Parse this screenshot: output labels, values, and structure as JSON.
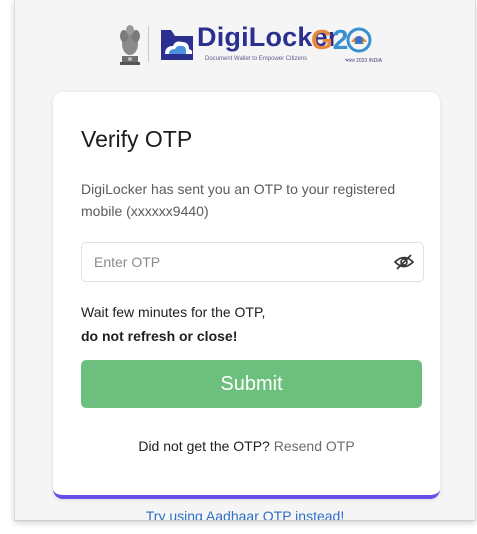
{
  "header": {
    "brand_name": "DigiLocker",
    "brand_tagline": "Document Wallet to Empower Citizens",
    "g20_mark": "G20",
    "g20_small": "भारत 2023 INDIA",
    "icons": [
      "national-emblem",
      "digilocker-cloud",
      "g20-logo"
    ]
  },
  "card": {
    "title": "Verify OTP",
    "description": "DigiLocker has sent you an OTP to your registered mobile (xxxxxx9440)",
    "otp_placeholder": "Enter OTP",
    "otp_value": "",
    "eye_icon": "eye-slash-icon",
    "wait_text": "Wait few minutes for the OTP,",
    "warning_text": "do not refresh or close!",
    "submit_label": "Submit",
    "resend_prompt": "Did not get the OTP?",
    "resend_link": "Resend OTP"
  },
  "footer": {
    "aadhaar_link": "Try using Aadhaar OTP instead!"
  },
  "colors": {
    "brand_blue": "#2b2f8f",
    "submit_green": "#6cbf7c",
    "accent_purple": "#6a4ce8",
    "link_blue": "#2d6fc7"
  }
}
